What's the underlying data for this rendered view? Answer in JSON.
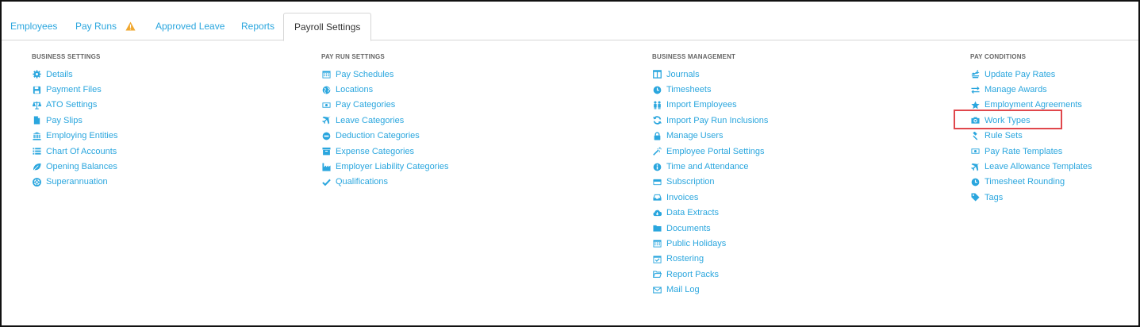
{
  "tabs": [
    {
      "label": "Employees",
      "warning": false
    },
    {
      "label": "Pay Runs",
      "warning": true
    },
    {
      "label": "Approved Leave",
      "warning": false
    },
    {
      "label": "Reports",
      "warning": false
    },
    {
      "label": "Payroll Settings",
      "warning": false,
      "active": true
    }
  ],
  "columns": [
    {
      "heading": "BUSINESS SETTINGS",
      "items": [
        {
          "label": "Details",
          "icon": "gear-icon"
        },
        {
          "label": "Payment Files",
          "icon": "floppy-disk-icon"
        },
        {
          "label": "ATO Settings",
          "icon": "scales-icon"
        },
        {
          "label": "Pay Slips",
          "icon": "file-icon"
        },
        {
          "label": "Employing Entities",
          "icon": "bank-icon"
        },
        {
          "label": "Chart Of Accounts",
          "icon": "list-icon"
        },
        {
          "label": "Opening Balances",
          "icon": "leaf-icon"
        },
        {
          "label": "Superannuation",
          "icon": "lifebuoy-icon"
        }
      ]
    },
    {
      "heading": "PAY RUN SETTINGS",
      "items": [
        {
          "label": "Pay Schedules",
          "icon": "calendar-icon"
        },
        {
          "label": "Locations",
          "icon": "globe-icon"
        },
        {
          "label": "Pay Categories",
          "icon": "money-icon"
        },
        {
          "label": "Leave Categories",
          "icon": "plane-icon"
        },
        {
          "label": "Deduction Categories",
          "icon": "minus-circle-icon"
        },
        {
          "label": "Expense Categories",
          "icon": "archive-icon"
        },
        {
          "label": "Employer Liability Categories",
          "icon": "industry-icon"
        },
        {
          "label": "Qualifications",
          "icon": "check-icon"
        }
      ]
    },
    {
      "heading": "BUSINESS MANAGEMENT",
      "items": [
        {
          "label": "Journals",
          "icon": "columns-icon"
        },
        {
          "label": "Timesheets",
          "icon": "clock-icon"
        },
        {
          "label": "Import Employees",
          "icon": "users-icon"
        },
        {
          "label": "Import Pay Run Inclusions",
          "icon": "refresh-icon"
        },
        {
          "label": "Manage Users",
          "icon": "lock-icon"
        },
        {
          "label": "Employee Portal Settings",
          "icon": "magic-wand-icon"
        },
        {
          "label": "Time and Attendance",
          "icon": "info-icon"
        },
        {
          "label": "Subscription",
          "icon": "credit-card-icon"
        },
        {
          "label": "Invoices",
          "icon": "inbox-icon"
        },
        {
          "label": "Data Extracts",
          "icon": "cloud-download-icon"
        },
        {
          "label": "Documents",
          "icon": "folder-icon"
        },
        {
          "label": "Public Holidays",
          "icon": "calendar-icon"
        },
        {
          "label": "Rostering",
          "icon": "calendar-check-icon"
        },
        {
          "label": "Report Packs",
          "icon": "folder-open-icon"
        },
        {
          "label": "Mail Log",
          "icon": "envelope-icon"
        }
      ]
    },
    {
      "heading": "PAY CONDITIONS",
      "items": [
        {
          "label": "Update Pay Rates",
          "icon": "coins-icon"
        },
        {
          "label": "Manage Awards",
          "icon": "exchange-icon"
        },
        {
          "label": "Employment Agreements",
          "icon": "star-icon"
        },
        {
          "label": "Work Types",
          "icon": "camera-icon"
        },
        {
          "label": "Rule Sets",
          "icon": "gavel-icon"
        },
        {
          "label": "Pay Rate Templates",
          "icon": "money-icon"
        },
        {
          "label": "Leave Allowance Templates",
          "icon": "plane-icon"
        },
        {
          "label": "Timesheet Rounding",
          "icon": "clock-icon"
        },
        {
          "label": "Tags",
          "icon": "tag-icon"
        }
      ]
    }
  ],
  "colors": {
    "link": "#2aa6de",
    "heading": "#666666",
    "warning": "#f0a830",
    "highlight": "#e0474c"
  }
}
